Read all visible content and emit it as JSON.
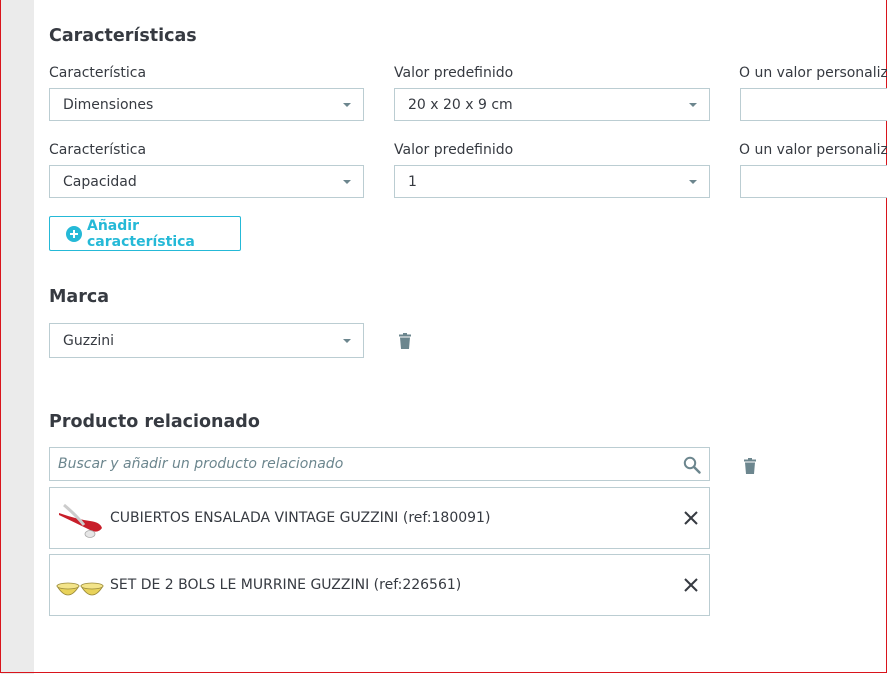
{
  "features": {
    "title": "Características",
    "rows": [
      {
        "feature_label": "Característica",
        "feature_value": "Dimensiones",
        "predef_label": "Valor predefinido",
        "predef_value": "20 x 20 x 9 cm",
        "custom_label": "O un valor personaliza",
        "custom_value": ""
      },
      {
        "feature_label": "Característica",
        "feature_value": "Capacidad",
        "predef_label": "Valor predefinido",
        "predef_value": "1",
        "custom_label": "O un valor personaliza",
        "custom_value": ""
      }
    ],
    "add_button_label": "Añadir característica"
  },
  "brand": {
    "title": "Marca",
    "value": "Guzzini"
  },
  "related": {
    "title": "Producto relacionado",
    "search_placeholder": "Buscar y añadir un producto relacionado",
    "products": [
      {
        "name": "CUBIERTOS ENSALADA VINTAGE GUZZINI (ref:180091)"
      },
      {
        "name": "SET DE 2 BOLS LE MURRINE GUZZINI (ref:226561)"
      }
    ]
  },
  "colors": {
    "accent": "#25b9d7",
    "border": "#bbcdd2",
    "text": "#363a41",
    "icon": "#6c868e"
  },
  "icons": [
    "plus-circle-icon",
    "caret-down-icon",
    "trash-icon",
    "search-icon",
    "close-icon"
  ]
}
